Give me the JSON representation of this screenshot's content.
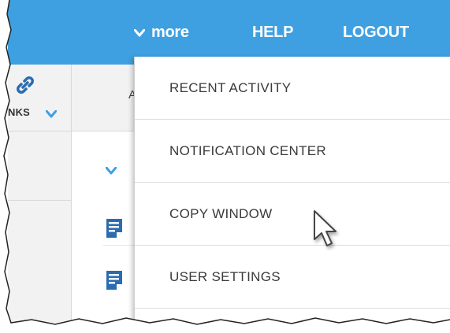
{
  "topnav": {
    "more_label": "more",
    "help_label": "HELP",
    "logout_label": "LOGOUT"
  },
  "leftpanel": {
    "links_label": "NKS"
  },
  "header": {
    "partial_letter": "A"
  },
  "dropdown": {
    "items": [
      {
        "label": "RECENT ACTIVITY"
      },
      {
        "label": "NOTIFICATION CENTER"
      },
      {
        "label": "COPY WINDOW"
      },
      {
        "label": "USER SETTINGS"
      }
    ]
  },
  "colors": {
    "topbar": "#3ea0e0",
    "accent_icon": "#2b6cb0",
    "menu_text": "#3a3a3a"
  },
  "icons": {
    "more": "chevron-down-icon",
    "links": "link-icon",
    "links_toggle": "chevron-down-icon",
    "content_toggle": "chevron-down-icon",
    "document": "document-icon",
    "pointer": "mouse-cursor-icon"
  }
}
